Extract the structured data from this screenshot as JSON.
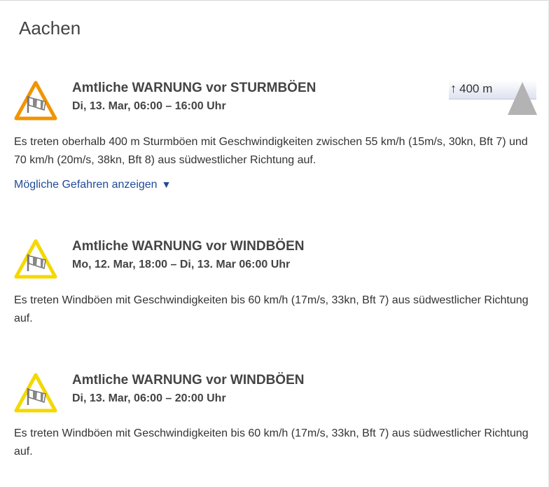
{
  "city": "Aachen",
  "colors": {
    "orange_warning": "#f29400",
    "yellow_warning": "#f5d800",
    "link": "#1f4b97"
  },
  "warnings": [
    {
      "level_color": "orange",
      "icon": "wind-sock-icon",
      "title": "Amtliche WARNUNG vor STURMBÖEN",
      "date": "Di, 13. Mar, 06:00 – 16:00 Uhr",
      "altitude": "400 m",
      "altitude_icon": "arrow-up-icon",
      "text": "Es treten oberhalb 400 m Sturmböen mit Geschwindigkeiten zwischen 55 km/h (15m/s, 30kn, Bft 7) und 70 km/h (20m/s, 38kn, Bft 8) aus südwestlicher Richtung auf.",
      "link": "Mögliche Gefahren anzeigen",
      "link_icon": "triangle-down-icon"
    },
    {
      "level_color": "yellow",
      "icon": "wind-sock-icon",
      "title": "Amtliche WARNUNG vor WINDBÖEN",
      "date": "Mo, 12. Mar, 18:00 – Di, 13. Mar 06:00 Uhr",
      "text": "Es treten Windböen mit Geschwindigkeiten bis 60 km/h (17m/s, 33kn, Bft 7) aus südwestlicher Richtung auf."
    },
    {
      "level_color": "yellow",
      "icon": "wind-sock-icon",
      "title": "Amtliche WARNUNG vor WINDBÖEN",
      "date": "Di, 13. Mar, 06:00 – 20:00 Uhr",
      "text": "Es treten Windböen mit Geschwindigkeiten bis 60 km/h (17m/s, 33kn, Bft 7) aus südwestlicher Richtung auf."
    }
  ]
}
